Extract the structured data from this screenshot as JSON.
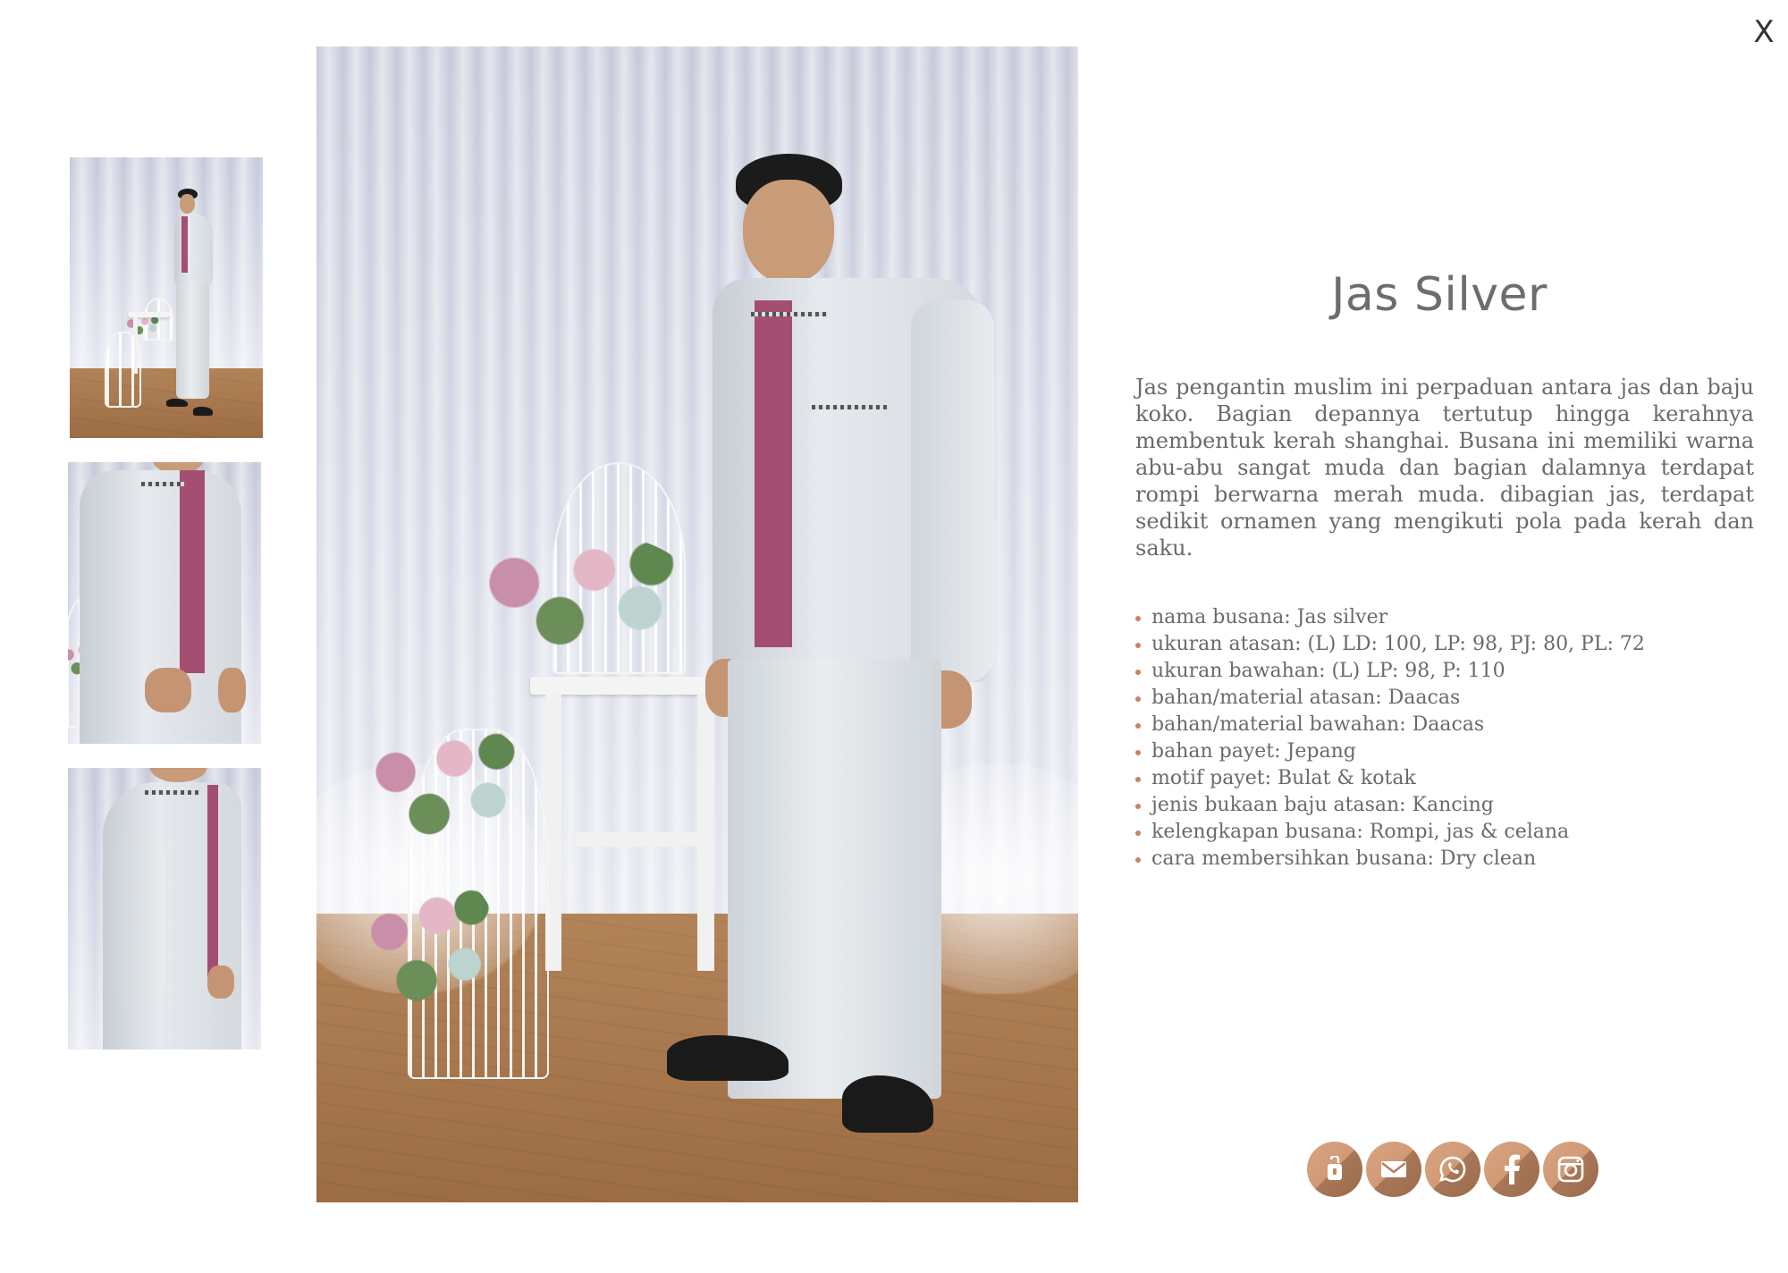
{
  "close_label": "X",
  "title": "Jas Silver",
  "description": "Jas pengantin muslim ini perpaduan antara jas dan baju koko. Bagian depannya tertutup hingga kerahnya membentuk kerah shanghai. Busana ini memiliki warna abu-abu sangat muda dan bagian dalamnya terdapat rompi berwarna merah muda. dibagian jas, terdapat sedikit ornamen yang mengikuti pola pada kerah dan saku.",
  "specs": [
    "nama busana: Jas silver",
    "ukuran atasan: (L) LD: 100, LP: 98, PJ: 80, PL: 72",
    "ukuran bawahan: (L) LP: 98, P: 110",
    "bahan/material atasan: Daacas",
    "bahan/material bawahan: Daacas",
    "bahan payet: Jepang",
    "motif payet: Bulat & kotak",
    "jenis bukaan baju atasan: Kancing",
    "kelengkapan busana: Rompi, jas & celana",
    "cara membersihkan busana: Dry clean"
  ],
  "thumbnails": [
    {
      "name": "thumb-full-body"
    },
    {
      "name": "thumb-torso"
    },
    {
      "name": "thumb-side"
    }
  ],
  "social": [
    {
      "name": "order-icon"
    },
    {
      "name": "email-icon"
    },
    {
      "name": "whatsapp-icon"
    },
    {
      "name": "facebook-icon"
    },
    {
      "name": "instagram-icon"
    }
  ],
  "colors": {
    "accent": "#c7845f",
    "text": "#6a6a6a",
    "title": "#6d6d6d",
    "jacket": "#dfe3e7",
    "vest": "#a44f72"
  }
}
